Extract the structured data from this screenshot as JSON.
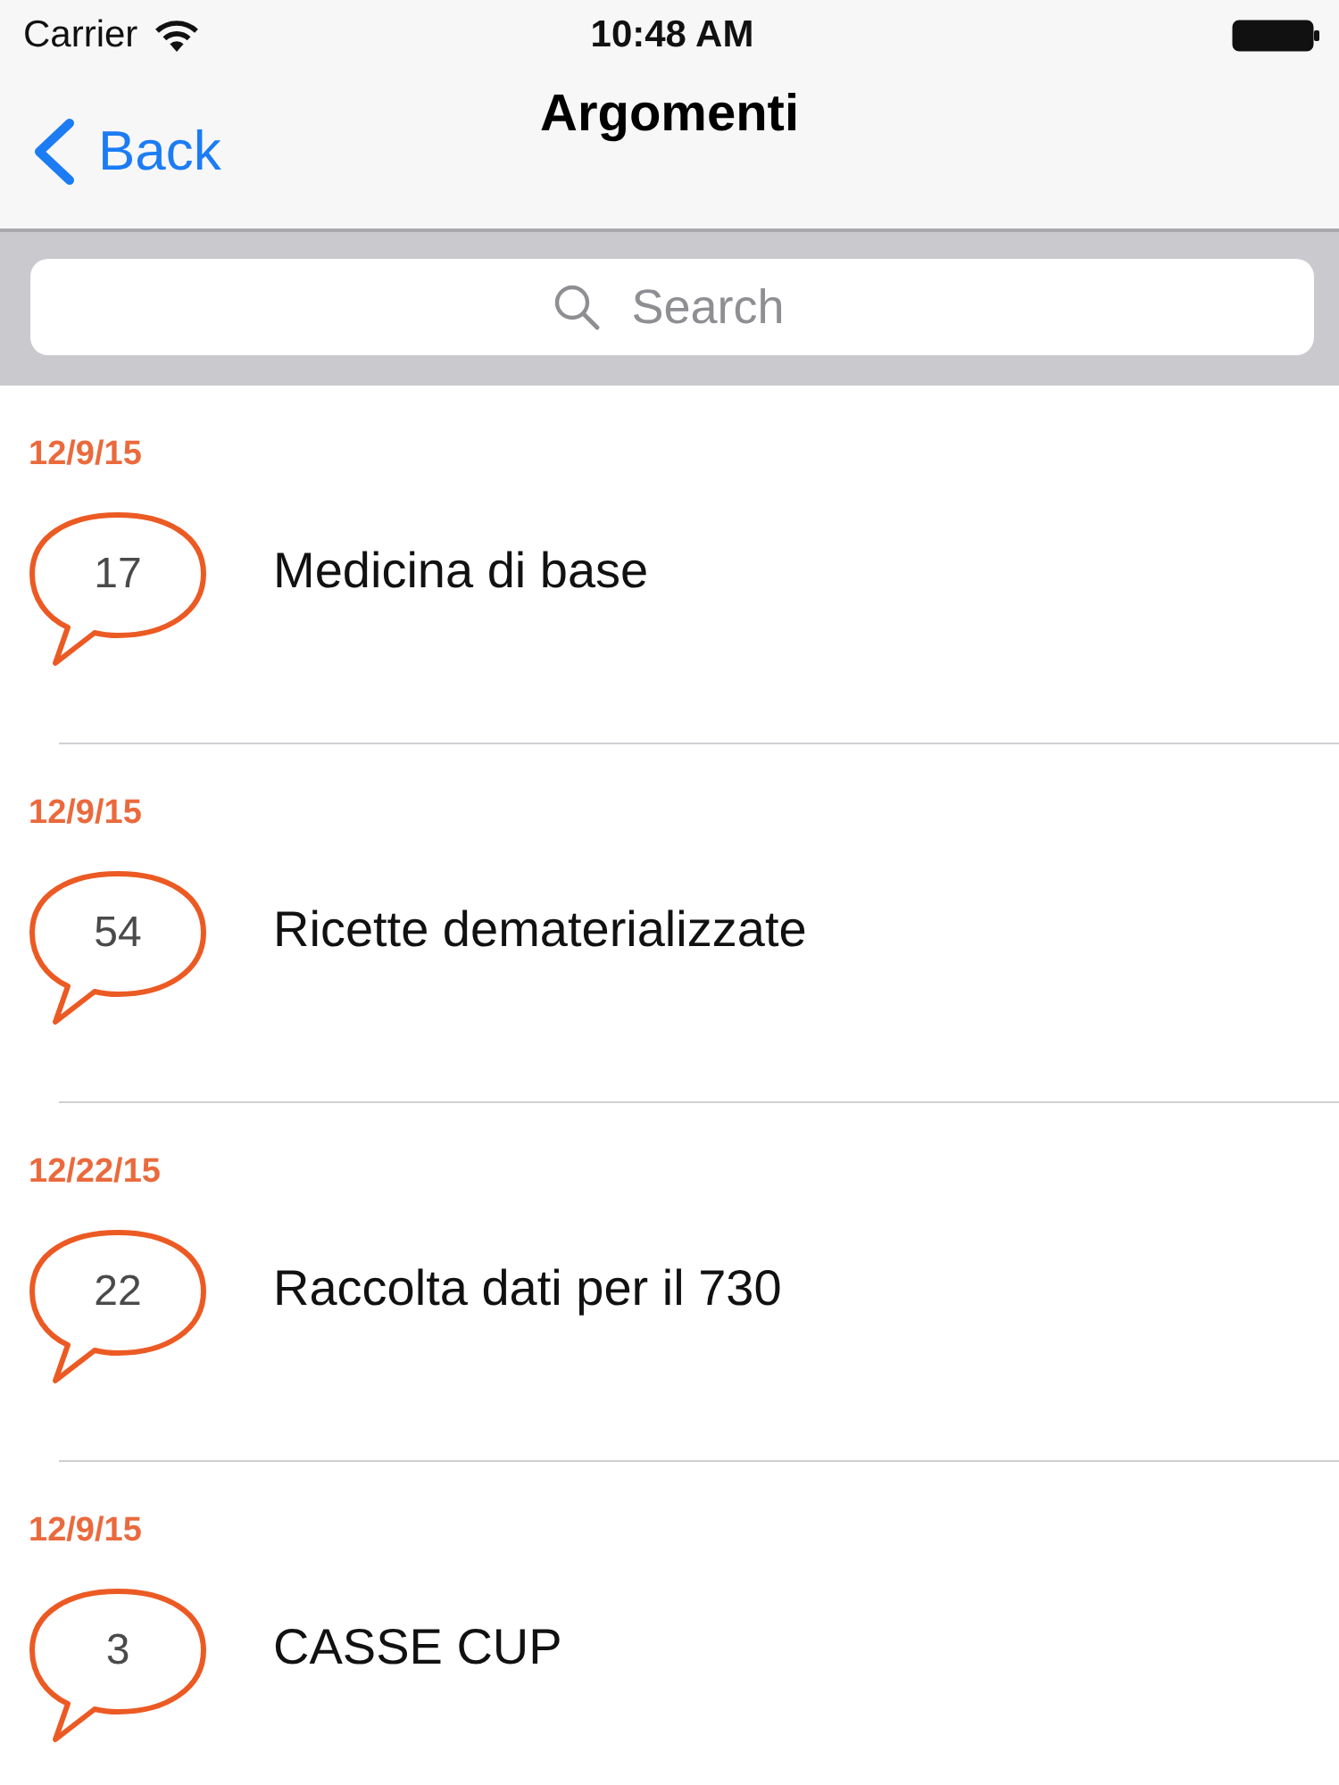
{
  "status_bar": {
    "carrier": "Carrier",
    "time": "10:48 AM"
  },
  "nav_bar": {
    "back_label": "Back",
    "title": "Argomenti"
  },
  "search": {
    "placeholder": "Search"
  },
  "topics": [
    {
      "date": "12/9/15",
      "count": "17",
      "title": "Medicina di base"
    },
    {
      "date": "12/9/15",
      "count": "54",
      "title": "Ricette dematerializzate"
    },
    {
      "date": "12/22/15",
      "count": "22",
      "title": "Raccolta dati per il 730"
    },
    {
      "date": "12/9/15",
      "count": "3",
      "title": "CASSE CUP"
    }
  ]
}
